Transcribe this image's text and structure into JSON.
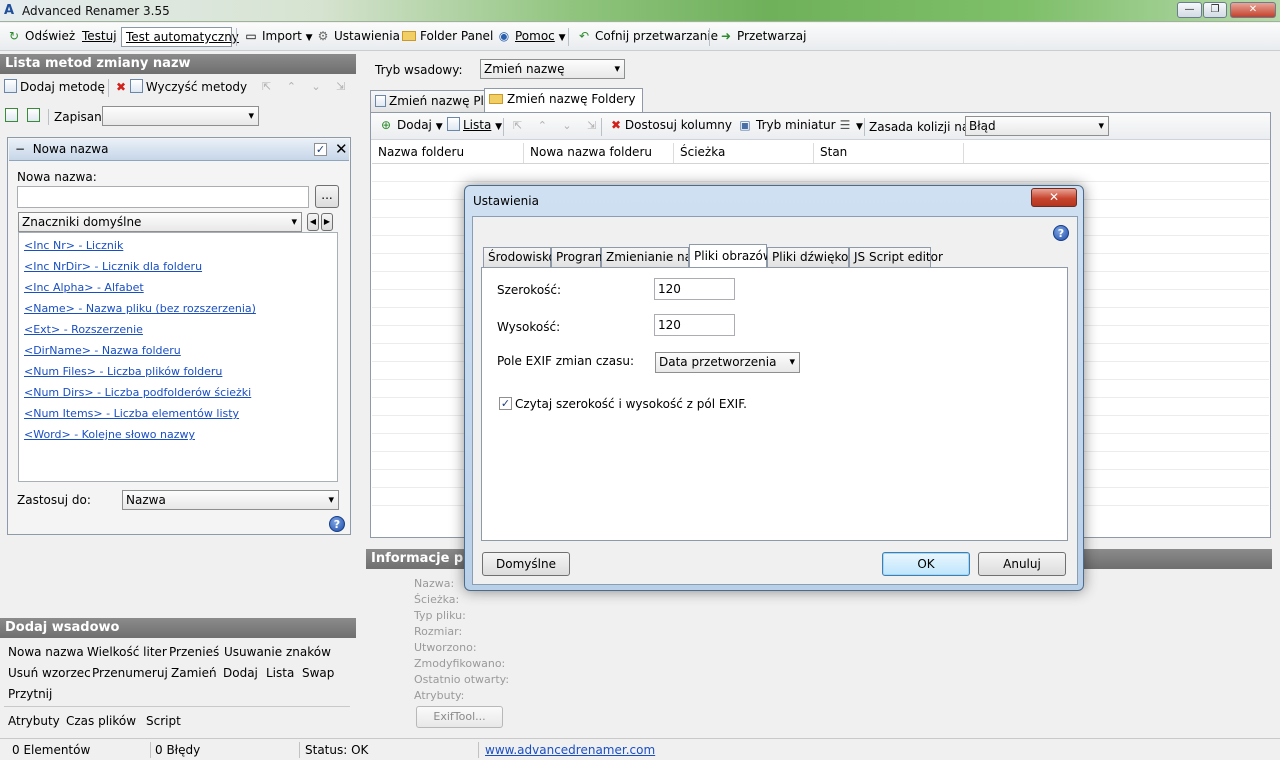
{
  "window": {
    "title": "Advanced Renamer 3.55"
  },
  "toolbar": {
    "refresh": "Odśwież",
    "test": "Testuj",
    "auto_test": "Test automatyczny",
    "import": "Import",
    "settings": "Ustawienia",
    "folder_panel": "Folder Panel",
    "help": "Pomoc",
    "undo": "Cofnij przetwarzanie",
    "process": "Przetwarzaj"
  },
  "left": {
    "methods_header": "Lista metod zmiany nazw",
    "add_method": "Dodaj metodę",
    "clear_methods": "Wyczyść metody",
    "saved_label": "Zapisane:",
    "method": {
      "title": "Nowa nazwa",
      "new_name_label": "Nowa nazwa:",
      "new_name_value": "",
      "browse_btn": "...",
      "tags_dropdown": "Znaczniki domyślne",
      "tags": [
        "<Inc Nr> - Licznik",
        "<Inc NrDir> - Licznik dla folderu",
        "<Inc Alpha> - Alfabet",
        "<Name> - Nazwa pliku (bez rozszerzenia)",
        "<Ext> - Rozszerzenie",
        "<DirName> - Nazwa folderu",
        "<Num Files> - Liczba plików folderu",
        "<Num Dirs> - Liczba podfolderów ścieżki",
        "<Num Items> - Liczba elementów listy",
        "<Word> - Kolejne słowo nazwy"
      ],
      "apply_to_label": "Zastosuj do:",
      "apply_to_value": "Nazwa"
    },
    "batch_header": "Dodaj wsadowo",
    "batch_row1": [
      "Nowa nazwa",
      "Wielkość liter",
      "Przenieś",
      "Usuwanie znaków"
    ],
    "batch_row2": [
      "Usuń wzorzec",
      "Przenumeruj",
      "Zamień",
      "Dodaj",
      "Lista",
      "Swap"
    ],
    "batch_row3": [
      "Przytnij"
    ],
    "batch_row4": [
      "Atrybuty",
      "Czas plików",
      "Script"
    ]
  },
  "right": {
    "batch_mode_label": "Tryb wsadowy:",
    "batch_mode_value": "Zmień nazwę",
    "tabs": [
      "Zmień nazwę Pliki",
      "Zmień nazwę Foldery"
    ],
    "grid_toolbar": {
      "add": "Dodaj",
      "list": "Lista",
      "columns": "Dostosuj kolumny",
      "thumbs": "Tryb miniatur",
      "collision_label": "Zasada kolizji nazw:",
      "collision_value": "Błąd"
    },
    "columns": [
      "Nazwa folderu",
      "Nowa nazwa folderu",
      "Ścieżka",
      "Stan"
    ],
    "info_header": "Informacje pliku",
    "info_labels": [
      "Nazwa:",
      "Ścieżka:",
      "Typ pliku:",
      "Rozmiar:",
      "Utworzono:",
      "Zmodyfikowano:",
      "Ostatnio otwarty:",
      "Atrybuty:"
    ],
    "exiftool_btn": "ExifTool..."
  },
  "status": {
    "items": "0 Elementów",
    "errors": "0 Błędy",
    "status": "Status: OK",
    "website": "www.advancedrenamer.com"
  },
  "dialog": {
    "title": "Ustawienia",
    "close": "✕",
    "tabs": [
      "Środowisko",
      "Program",
      "Zmienianie nazw",
      "Pliki obrazów",
      "Pliki dźwiękowe",
      "JS Script editor"
    ],
    "width_label": "Szerokość:",
    "width_value": "120",
    "height_label": "Wysokość:",
    "height_value": "120",
    "exif_label": "Pole EXIF zmian czasu:",
    "exif_value": "Data przetworzenia",
    "read_exif_label": "Czytaj szerokość i wysokość z pól EXIF.",
    "read_exif_checked": "✓",
    "defaults_btn": "Domyślne",
    "ok_btn": "OK",
    "cancel_btn": "Anuluj"
  }
}
